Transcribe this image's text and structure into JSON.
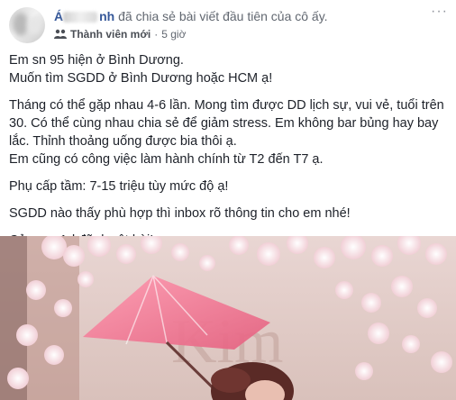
{
  "post": {
    "author": {
      "name_visible": "Á",
      "name_end": "nh"
    },
    "action": "đã chia sẻ bài viết đầu tiên của cô ấy.",
    "badge": "Thành viên mới",
    "separator": "·",
    "time": "5 giờ",
    "more_label": "···",
    "body": [
      "Em sn 95 hiện ở Bình Dương.",
      "Muốn tìm SGDD ở Bình Dương hoặc HCM ạ!",
      "Tháng có thể gặp nhau 4-6 lần. Mong tìm được DD lịch sự, vui vẻ, tuổi trên 30. Có thể cùng nhau chia sẻ để giảm stress. Em không bar bủng hay bay lắc. Thỉnh thoảng uống được bia thôi ạ.",
      "Em cũng có công việc làm hành chính từ T2 đến T7 ạ.",
      "Phụ cấp tầm: 7-15 triệu tùy mức độ ạ!",
      "SGDD nào thấy phù hợp thì inbox rõ thông tin cho em nhé!",
      "Cảm ơn Ad đã duyệt bài!"
    ],
    "photo": {
      "sign_text": "Kim"
    }
  },
  "colors": {
    "link": "#365899",
    "meta": "#616770",
    "text": "#1d2129"
  }
}
